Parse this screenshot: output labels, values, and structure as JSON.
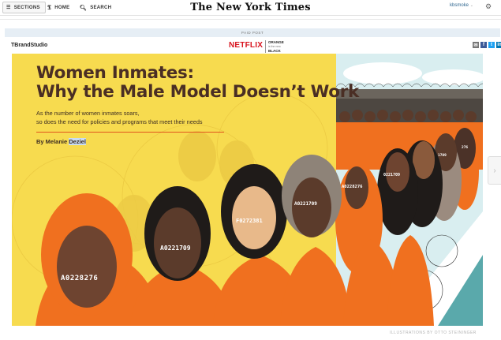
{
  "topbar": {
    "sections_label": "SECTIONS",
    "home_label": "HOME",
    "search_label": "SEARCH",
    "masthead": "The New York Times",
    "user_label": "kbsmoke"
  },
  "paid_post_label": "PAID POST",
  "brand": {
    "studio": "TBrandStudio",
    "sponsor": "NETFLIX",
    "show_line1": "ORANGE",
    "show_line2": "is the new",
    "show_line3": "BLACK"
  },
  "article": {
    "headline_line1": "Women Inmates:",
    "headline_line2": "Why the Male Model Doesn’t Work",
    "dek_line1": "As the number of women inmates soars,",
    "dek_line2": "so does the need for policies and programs that meet their needs",
    "byline_prefix": "By Melanie ",
    "byline_highlight": "Deziel"
  },
  "inmates": {
    "id1": "A0228276",
    "id2": "A0221709",
    "id3": "F0272381",
    "id4": "A0221709",
    "id5": "A0228276",
    "id6": "A0221709",
    "id7": "0221709",
    "id8": "1709",
    "id9": "276"
  },
  "credit": "ILLUSTRATIONS BY OTTO STEININGER",
  "colors": {
    "yellow": "#f7db4f",
    "orange": "#f0701f",
    "brown": "#4a2e24",
    "teal": "#5aa9ab",
    "sky": "#d9eef0"
  }
}
